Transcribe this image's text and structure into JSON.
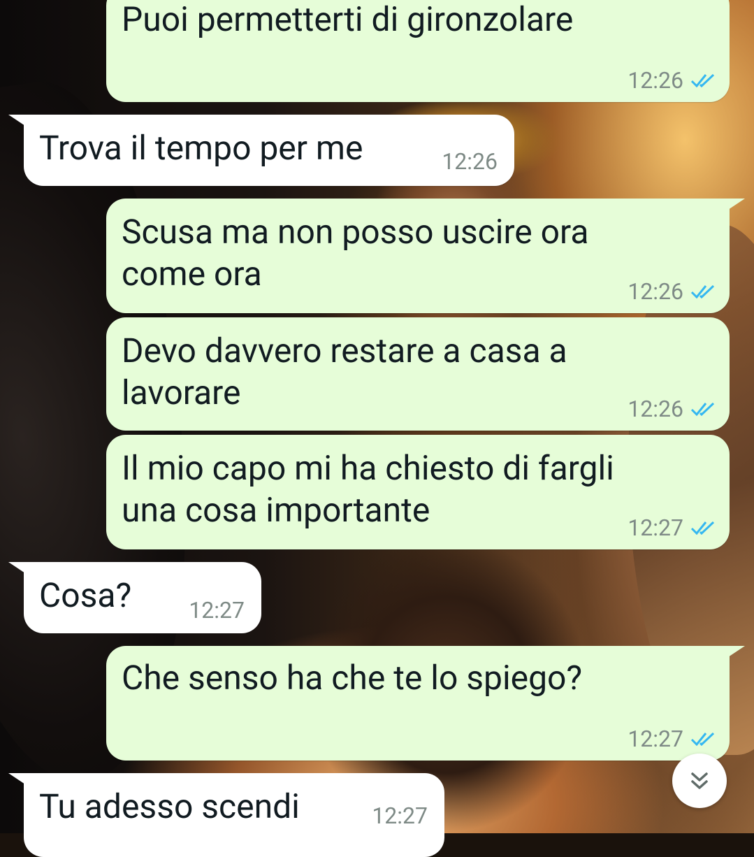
{
  "chat": {
    "messages": [
      {
        "direction": "out",
        "text": "Puoi permetterti di gironzolare",
        "time": "12:26",
        "status_icon": "double-check-read-icon"
      },
      {
        "direction": "in",
        "text": "Trova il tempo per me",
        "time": "12:26"
      },
      {
        "direction": "out",
        "text": "Scusa ma non posso uscire ora\ncome ora",
        "time": "12:26",
        "status_icon": "double-check-read-icon"
      },
      {
        "direction": "out",
        "text": "Devo davvero restare a casa a\nlavorare",
        "time": "12:26",
        "status_icon": "double-check-read-icon"
      },
      {
        "direction": "out",
        "text": "Il mio capo mi ha chiesto di fargli\nuna cosa importante",
        "time": "12:27",
        "status_icon": "double-check-read-icon"
      },
      {
        "direction": "in",
        "text": "Cosa?",
        "time": "12:27"
      },
      {
        "direction": "out",
        "text": "Che senso ha che te lo spiego?",
        "time": "12:27",
        "status_icon": "double-check-read-icon"
      },
      {
        "direction": "in",
        "text": "Tu adesso scendi",
        "time": "12:27"
      }
    ],
    "scroll_button_icon": "double-chevron-down-icon"
  },
  "colors": {
    "outgoing_bubble": "#e6fdd8",
    "incoming_bubble": "#ffffff",
    "read_ticks": "#34b7f1",
    "timestamp": "#7e8a86"
  }
}
